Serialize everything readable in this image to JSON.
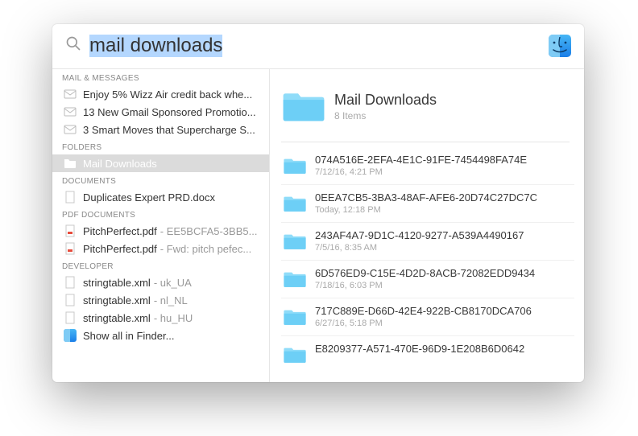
{
  "search": {
    "value": "mail downloads"
  },
  "left": {
    "sections": [
      {
        "header": "MAIL & MESSAGES",
        "kind": "mail",
        "items": [
          {
            "label": "Enjoy 5% Wizz Air credit back whe..."
          },
          {
            "label": "13 New Gmail Sponsored Promotio..."
          },
          {
            "label": "3 Smart Moves that Supercharge S..."
          }
        ]
      },
      {
        "header": "FOLDERS",
        "kind": "folder",
        "items": [
          {
            "label": "Mail Downloads",
            "selected": true
          }
        ]
      },
      {
        "header": "DOCUMENTS",
        "kind": "doc",
        "items": [
          {
            "label": "Duplicates Expert PRD.docx"
          }
        ]
      },
      {
        "header": "PDF DOCUMENTS",
        "kind": "pdf",
        "items": [
          {
            "label": "PitchPerfect.pdf",
            "meta": "- EE5BCFA5-3BB5..."
          },
          {
            "label": "PitchPerfect.pdf",
            "meta": "- Fwd: pitch pefec..."
          }
        ]
      },
      {
        "header": "DEVELOPER",
        "kind": "doc",
        "items": [
          {
            "label": "stringtable.xml",
            "meta": "- uk_UA"
          },
          {
            "label": "stringtable.xml",
            "meta": "- nl_NL"
          },
          {
            "label": "stringtable.xml",
            "meta": "- hu_HU"
          }
        ]
      }
    ],
    "show_all": "Show all in Finder..."
  },
  "preview": {
    "title": "Mail Downloads",
    "subtitle": "8 Items",
    "items": [
      {
        "name": "074A516E-2EFA-4E1C-91FE-7454498FA74E",
        "date": "7/12/16, 4:21 PM"
      },
      {
        "name": "0EEA7CB5-3BA3-48AF-AFE6-20D74C27DC7C",
        "date": "Today, 12:18 PM"
      },
      {
        "name": "243AF4A7-9D1C-4120-9277-A539A4490167",
        "date": "7/5/16, 8:35 AM"
      },
      {
        "name": "6D576ED9-C15E-4D2D-8ACB-72082EDD9434",
        "date": "7/18/16, 6:03 PM"
      },
      {
        "name": "717C889E-D66D-42E4-922B-CB8170DCA706",
        "date": "6/27/16, 5:18 PM"
      },
      {
        "name": "E8209377-A571-470E-96D9-1E208B6D0642",
        "date": ""
      }
    ]
  }
}
